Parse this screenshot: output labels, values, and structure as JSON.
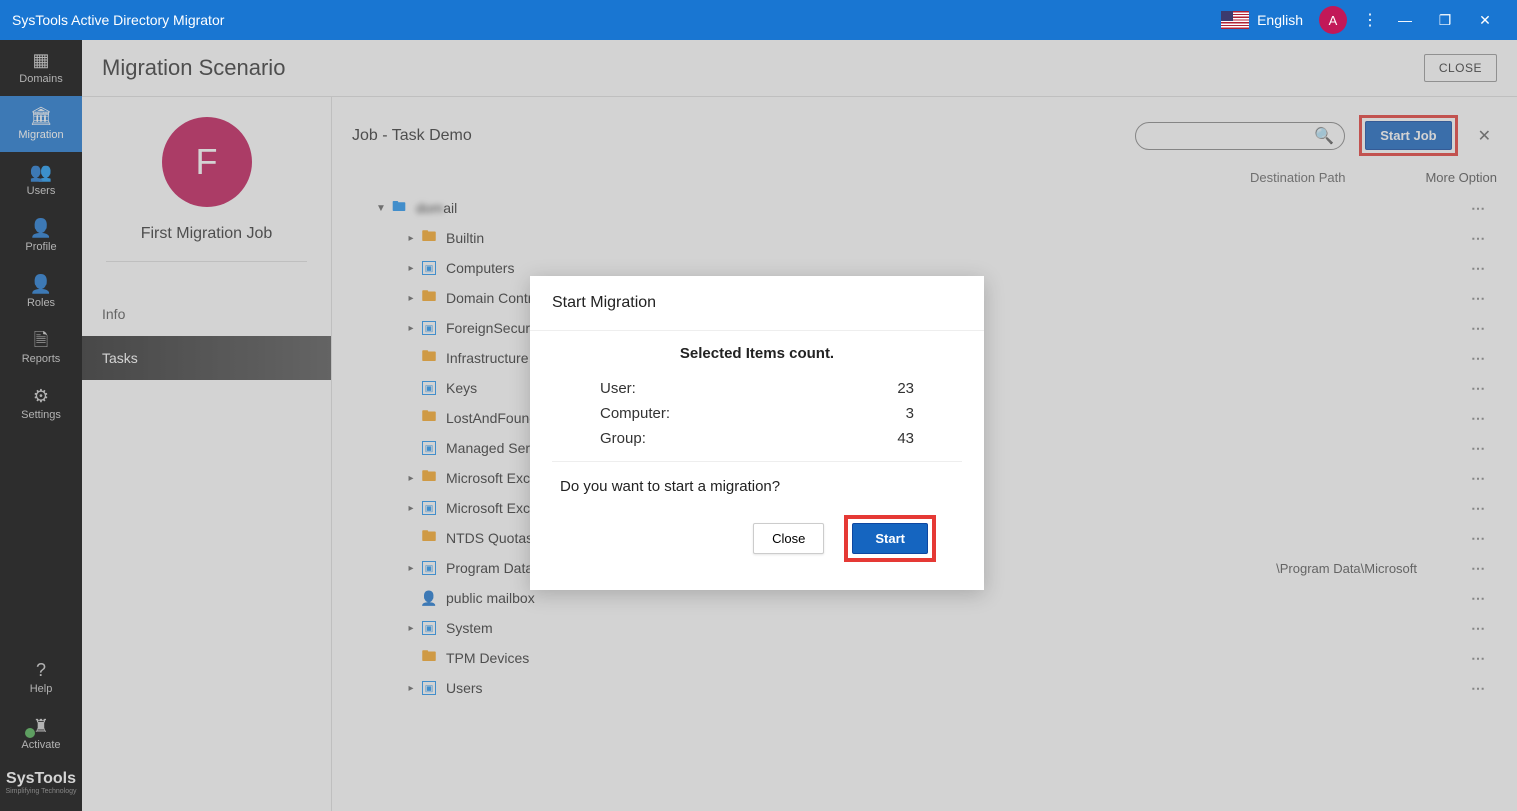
{
  "app": {
    "title": "SysTools Active Directory Migrator",
    "language": "English",
    "user_initial": "A"
  },
  "sidebar": {
    "items": [
      {
        "label": "Domains",
        "icon": "🏢"
      },
      {
        "label": "Migration",
        "icon": "🏛+",
        "active": true
      },
      {
        "label": "Users",
        "icon": "👥"
      },
      {
        "label": "Profile",
        "icon": "👤"
      },
      {
        "label": "Roles",
        "icon": "👤▾"
      },
      {
        "label": "Reports",
        "icon": "📄"
      },
      {
        "label": "Settings",
        "icon": "⚙"
      }
    ],
    "help_label": "Help",
    "activate_label": "Activate",
    "brand": "SysTools",
    "brand_tag": "Simplifying Technology"
  },
  "page": {
    "title": "Migration Scenario",
    "close_label": "CLOSE"
  },
  "job": {
    "avatar_letter": "F",
    "name": "First Migration Job",
    "nav": [
      {
        "label": "Info"
      },
      {
        "label": "Tasks",
        "active": true
      }
    ]
  },
  "detail": {
    "title": "Job - Task Demo",
    "start_job_label": "Start Job",
    "destination_path_label": "Destination Path",
    "more_option_label": "More Option",
    "root_suffix": "ail",
    "tree": [
      {
        "label": "Builtin",
        "type": "folder",
        "expandable": true
      },
      {
        "label": "Computers",
        "type": "ou",
        "expandable": true
      },
      {
        "label": "Domain Controllers",
        "type": "folder",
        "expandable": true
      },
      {
        "label": "ForeignSecurity",
        "type": "ou",
        "expandable": true
      },
      {
        "label": "Infrastructure",
        "type": "folder",
        "expandable": false
      },
      {
        "label": "Keys",
        "type": "ou",
        "expandable": false
      },
      {
        "label": "LostAndFound",
        "type": "folder",
        "expandable": false
      },
      {
        "label": "Managed Servic",
        "type": "ou",
        "expandable": false
      },
      {
        "label": "Microsoft Excha",
        "type": "folder",
        "expandable": true
      },
      {
        "label": "Microsoft Excha",
        "type": "ou",
        "expandable": true
      },
      {
        "label": "NTDS Quotas",
        "type": "folder",
        "expandable": false
      },
      {
        "label": "Program Data",
        "type": "ou",
        "expandable": true,
        "dest": "\\Program Data\\Microsoft"
      },
      {
        "label": "public mailbox",
        "type": "person",
        "expandable": false
      },
      {
        "label": "System",
        "type": "ou",
        "expandable": true
      },
      {
        "label": "TPM Devices",
        "type": "folder",
        "expandable": false
      },
      {
        "label": "Users",
        "type": "ou",
        "expandable": true
      }
    ]
  },
  "dialog": {
    "title": "Start Migration",
    "counts_title": "Selected Items count.",
    "counts": [
      {
        "key": "User:",
        "val": "23"
      },
      {
        "key": "Computer:",
        "val": "3"
      },
      {
        "key": "Group:",
        "val": "43"
      }
    ],
    "confirm": "Do you want to start a migration?",
    "close_label": "Close",
    "start_label": "Start"
  }
}
